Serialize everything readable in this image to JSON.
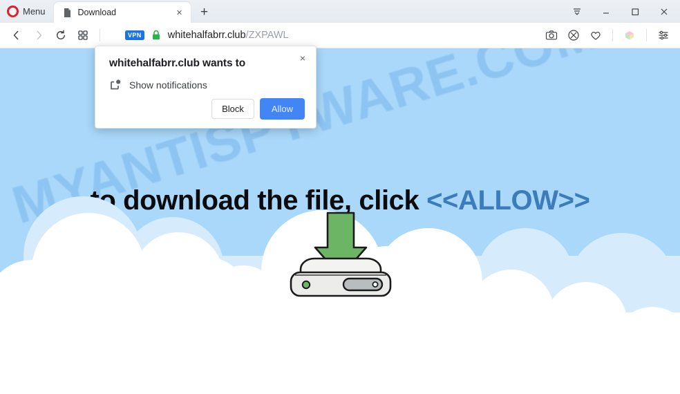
{
  "browser": {
    "menu_label": "Menu",
    "tab": {
      "title": "Download",
      "favicon": "document-icon",
      "close_label": "×"
    },
    "new_tab_label": "+",
    "window_controls": {
      "tab_menu": "tab-menu-icon",
      "minimize": "minimize-icon",
      "maximize": "maximize-icon",
      "close": "close-icon"
    },
    "nav": {
      "back": "back-arrow-icon",
      "forward": "forward-arrow-icon",
      "reload": "reload-icon",
      "speed_dial": "speed-dial-icon"
    },
    "address": {
      "vpn_badge": "VPN",
      "lock": "padlock-icon",
      "domain": "whitehalfabrr.club",
      "path": "/ZXPAWL"
    },
    "toolbar_icons": [
      {
        "name": "snapshot-camera-icon"
      },
      {
        "name": "ad-blocker-shield-icon"
      },
      {
        "name": "heart-favorite-icon"
      },
      {
        "name": "extension-icon"
      },
      {
        "name": "easy-setup-sliders-icon"
      }
    ]
  },
  "dialog": {
    "title": "whitehalfabrr.club wants to",
    "permission_icon": "notification-bell-icon",
    "permission_text": "Show notifications",
    "block_label": "Block",
    "allow_label": "Allow",
    "close_label": "×"
  },
  "page": {
    "headline_prefix": "to download the file, click",
    "headline_allow": "<<ALLOW>>",
    "watermark": "MYANTISPYWARE.COM",
    "illustration": "hard-drive-download-icon"
  },
  "colors": {
    "sky": "#a9d8fa",
    "cloud": "#ffffff",
    "allow_word": "#3d7cba",
    "allow_button": "#4285f4",
    "vpn_badge": "#1a73e8",
    "lock_green": "#2bb24c",
    "arrow_green": "#66b461",
    "opera_red": "#d6232c"
  }
}
